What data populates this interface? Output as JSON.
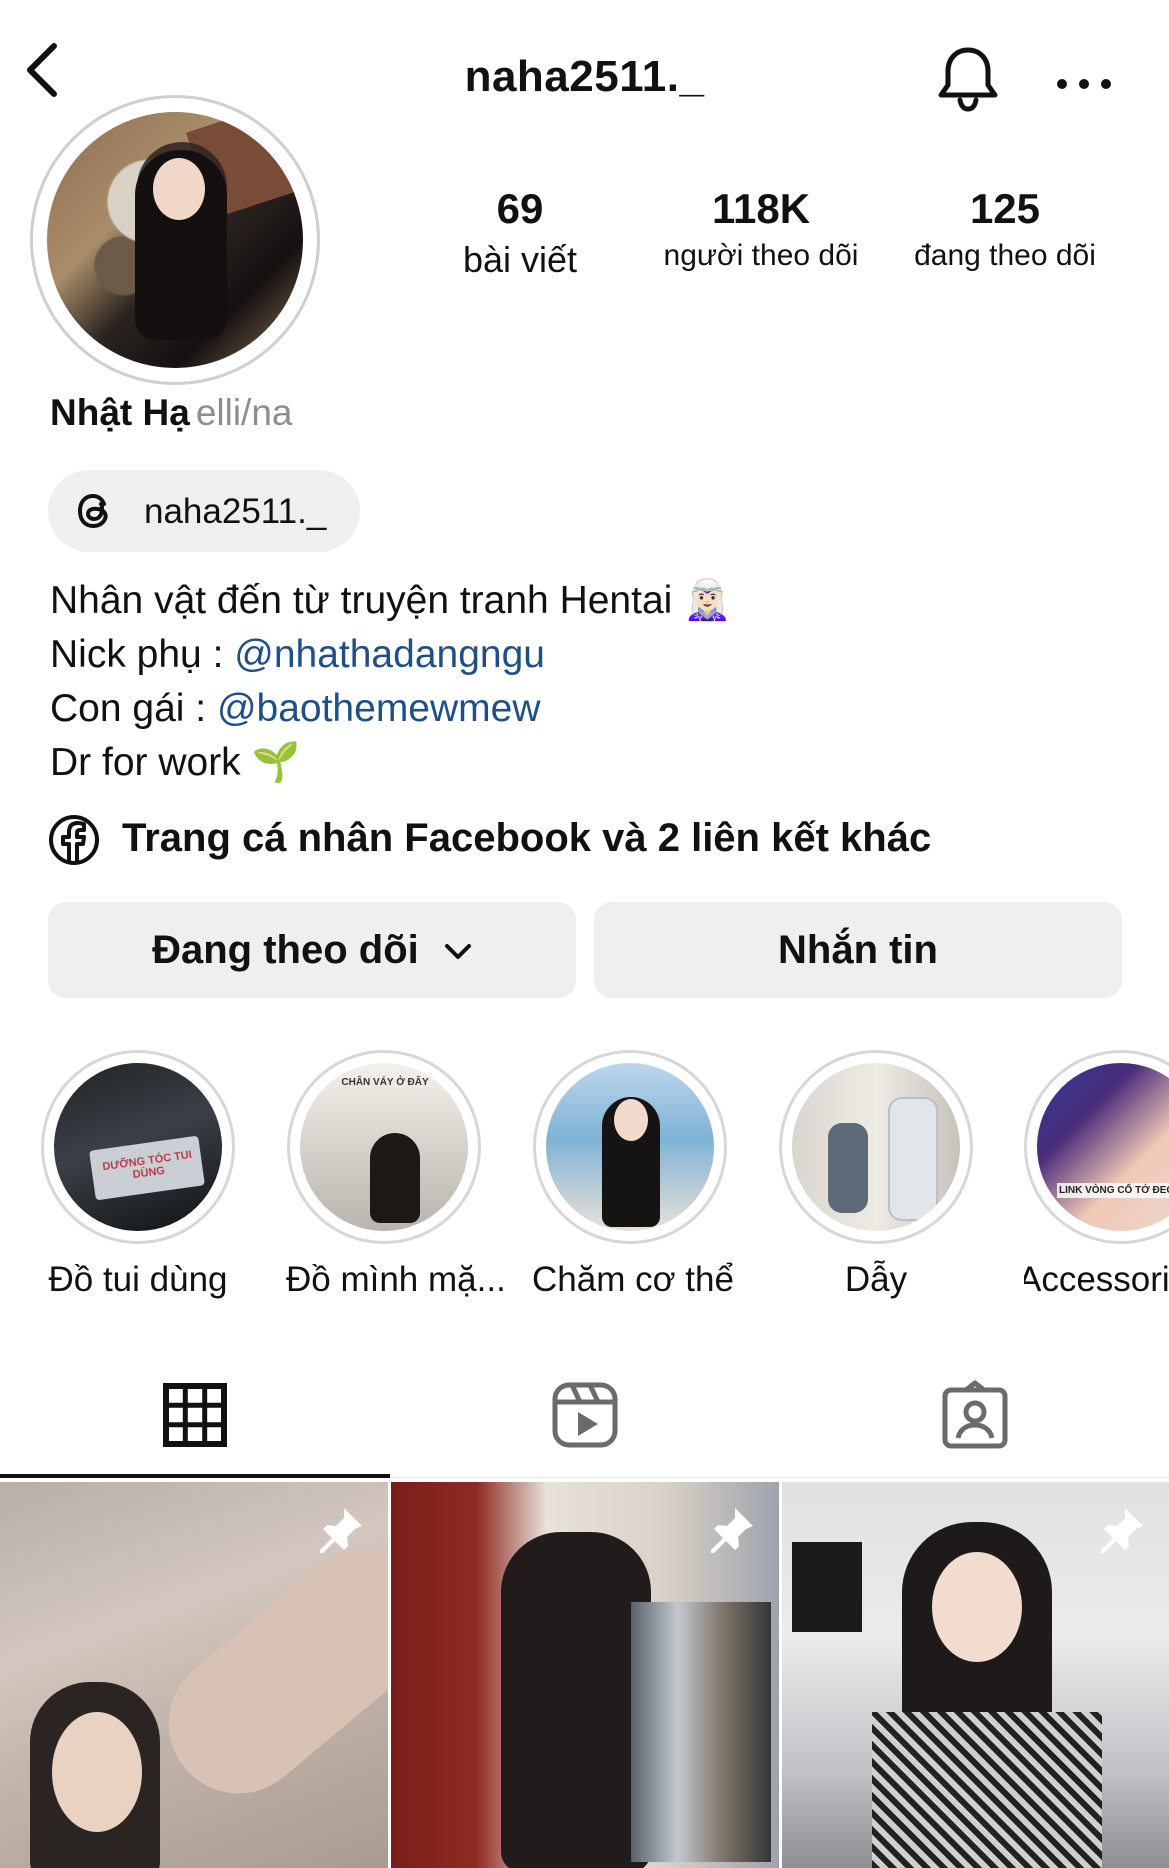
{
  "header": {
    "username": "naha2511._",
    "back_icon": "chevron-left-icon",
    "bell_icon": "bell-icon",
    "more_icon": "more-horizontal-icon"
  },
  "stats": [
    {
      "value": "69",
      "label": "bài viết"
    },
    {
      "value": "118K",
      "label": "người theo dõi"
    },
    {
      "value": "125",
      "label": "đang theo dõi"
    }
  ],
  "profile": {
    "name": "Nhật Hạ",
    "pronouns": "elli/na",
    "threads_handle": "naha2511._"
  },
  "bio": {
    "line1": "Nhân vật đến từ truyện tranh Hentai 🧝🏻‍♀️",
    "line2_prefix": "Nick phụ : ",
    "line2_mention": "@nhathadangngu",
    "line3_prefix": "Con gái : ",
    "line3_mention": "@baothemewmew",
    "line4": "Dr for work 🌱"
  },
  "links": {
    "facebook_text": "Trang cá nhân Facebook và 2 liên kết khác"
  },
  "actions": {
    "following_label": "Đang theo dõi",
    "message_label": "Nhắn tin"
  },
  "highlights": [
    {
      "label": "Đồ tui dùng",
      "overlay": "DƯỠNG TÓC TUI DÙNG"
    },
    {
      "label": "Đồ mình mặ...",
      "overlay": "CHÂN VÁY Ở ĐÂY"
    },
    {
      "label": "Chăm cơ thể",
      "overlay": ""
    },
    {
      "label": "Dẫy",
      "overlay": ""
    },
    {
      "label": "Accessori",
      "overlay": "LINK VÒNG CỔ TỚ ĐEO"
    }
  ],
  "tabs": {
    "grid_icon": "grid-icon",
    "reels_icon": "reels-icon",
    "tagged_icon": "tagged-icon",
    "active": "grid"
  },
  "grid": {
    "pin_icon": "pin-icon",
    "pinned_count": 3
  },
  "colors": {
    "mention": "#1f4f86",
    "button_bg": "#efefef",
    "muted_text": "#8e8e8e"
  }
}
